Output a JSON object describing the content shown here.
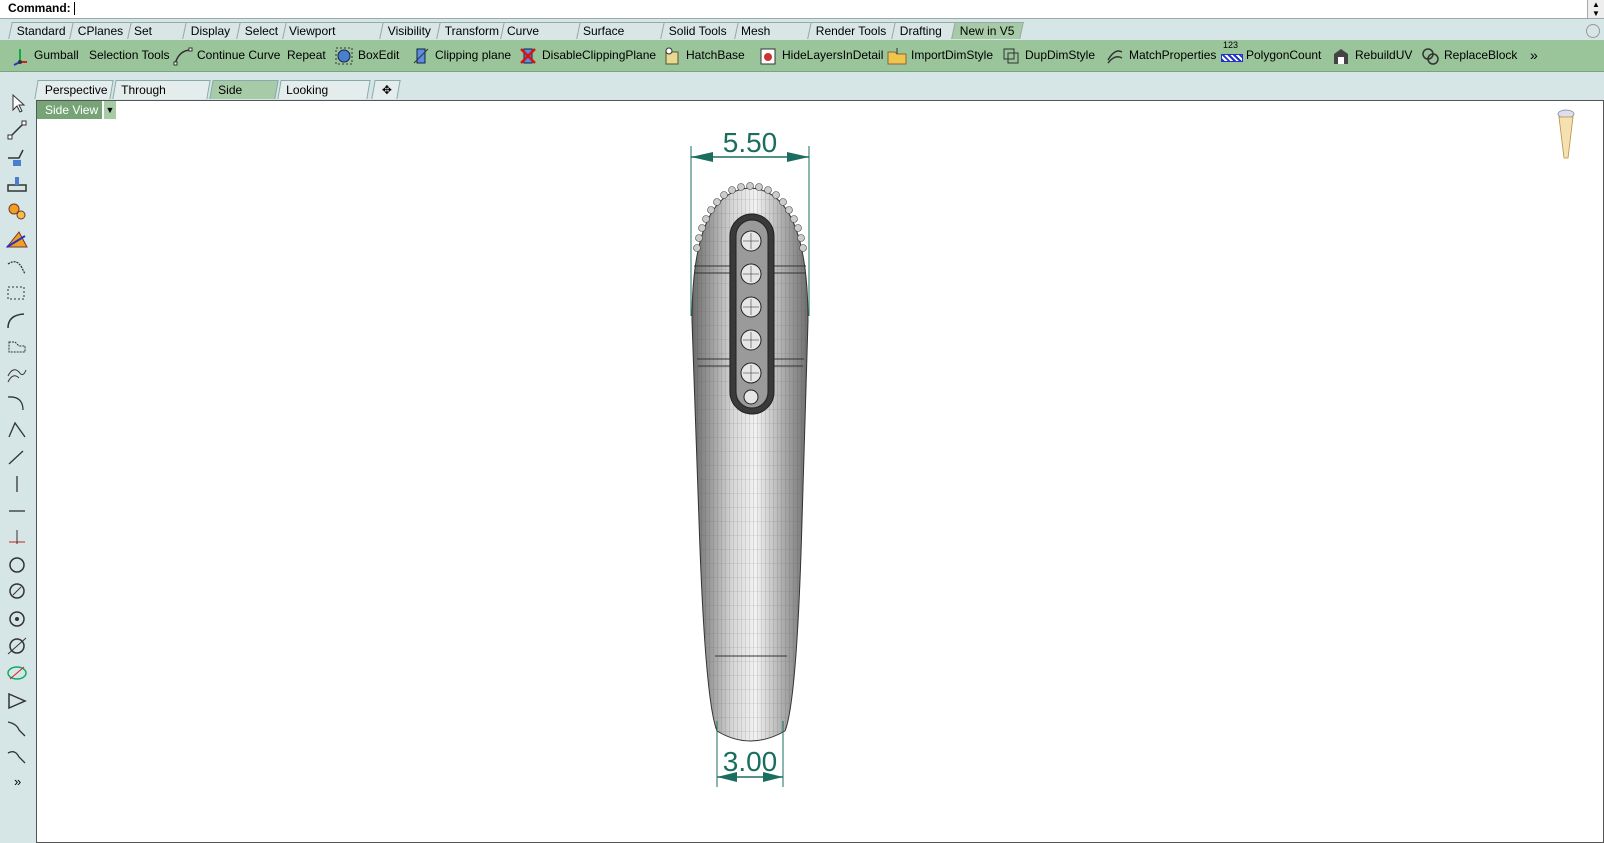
{
  "command": {
    "label": "Command:"
  },
  "tabs": [
    "Standard",
    "CPlanes",
    "Set View",
    "Display",
    "Select",
    "Viewport Layout",
    "Visibility",
    "Transform",
    "Curve Tools",
    "Surface Tools",
    "Solid Tools",
    "Mesh Tools",
    "Render Tools",
    "Drafting",
    "New in V5"
  ],
  "active_tab": "New in V5",
  "toolbar": {
    "gumball": "Gumball",
    "selection_tools": "Selection Tools",
    "continue_curve": "Continue Curve",
    "repeat": "Repeat",
    "boxedit": "BoxEdit",
    "clipping_plane": "Clipping plane",
    "disable_clipping": "DisableClippingPlane",
    "hatchbase": "HatchBase",
    "hidelayers": "HideLayersInDetail",
    "importdim": "ImportDimStyle",
    "dupdim": "DupDimStyle",
    "matchprops": "MatchProperties",
    "polycount_badge": "123",
    "polycount": "PolygonCount",
    "rebuilduv": "RebuildUV",
    "replaceblock": "ReplaceBlock",
    "more": "»"
  },
  "viewport_tabs": [
    "Perspective",
    "Through Finger",
    "Side View",
    "Looking Down"
  ],
  "active_viewport_tab": "Side View",
  "viewport": {
    "label": "Side View",
    "dim_top": "5.50",
    "dim_bottom": "3.00"
  },
  "leftbar": {
    "more": "»"
  },
  "colors": {
    "toolbar_green": "#9ac49a",
    "active_tab": "#a7cba7",
    "dimension": "#1b6e5f"
  }
}
